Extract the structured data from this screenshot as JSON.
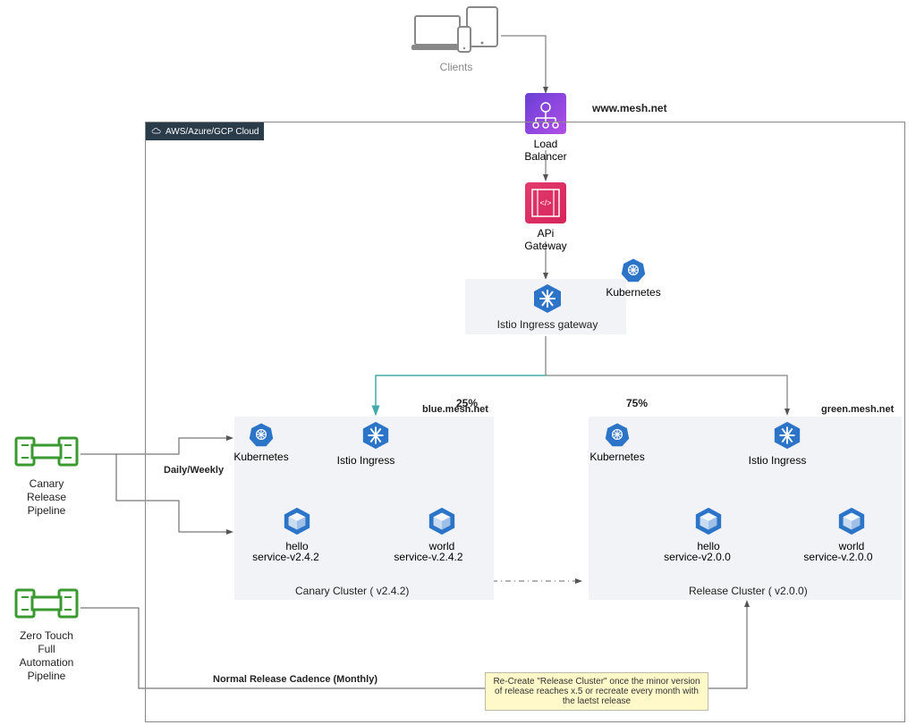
{
  "clients_label": "Clients",
  "mesh_url": "www.mesh.net",
  "load_balancer": "Load Balancer",
  "api_gateway": "APi Gateway",
  "cloud_title": "AWS/Azure/GCP Cloud",
  "kubernetes": "Kubernetes",
  "istio_ingress_gateway": "Istio Ingress gateway",
  "split": {
    "left": "25%",
    "right": "75%"
  },
  "blue": {
    "domain": "blue.mesh.net",
    "istio": "Istio Ingress",
    "hello_name": "hello",
    "hello_ver": "service-v2.4.2",
    "world_name": "world",
    "world_ver": "service-v.2.4.2",
    "cluster": "Canary Cluster ( v2.4.2)"
  },
  "green": {
    "domain": "green.mesh.net",
    "istio": "Istio Ingress",
    "hello_name": "hello",
    "hello_ver": "service-v2.0.0",
    "world_name": "world",
    "world_ver": "service-v.2.0.0",
    "cluster": "Release Cluster ( v2.0.0)"
  },
  "pipelines": {
    "canary": "Canary\nRelease\nPipeline",
    "zero": "Zero Touch\nFull\nAutomation\nPipeline"
  },
  "daily_weekly": "Daily/Weekly",
  "normal_cadence": "Normal Release Cadence (Monthly)",
  "note": "Re-Create \"Release Cluster\" once the minor version of release reaches x.5 or recreate every month with the laetst release"
}
